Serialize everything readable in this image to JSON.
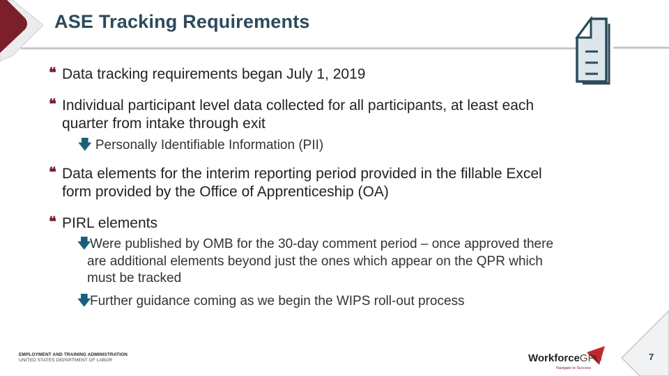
{
  "slide": {
    "title": "ASE Tracking Requirements",
    "page_number": "7",
    "bullets": [
      {
        "text": "Data tracking requirements began July 1, 2019",
        "icon": "quote-bullet-icon"
      },
      {
        "text_lines": [
          "Individual participant level data collected for all participants, at least each",
          "quarter from intake through exit"
        ],
        "icon": "quote-bullet-icon",
        "sub": [
          {
            "text": "Personally Identifiable Information (PII)",
            "icon": "down-arrow-icon"
          }
        ]
      },
      {
        "text_lines": [
          "Data elements for the interim reporting period provided in the fillable Excel",
          "form provided by the Office of Apprenticeship (OA)"
        ],
        "icon": "quote-bullet-icon"
      },
      {
        "text": "PIRL elements",
        "icon": "quote-bullet-icon",
        "sub": [
          {
            "text_lines": [
              "Were published by OMB for the 30-day comment period – once approved there",
              "are additional elements beyond just the ones which appear on the QPR which",
              "must be tracked"
            ],
            "icon": "down-arrow-icon"
          },
          {
            "text": "Further guidance coming as we begin the WIPS roll-out process",
            "icon": "down-arrow-icon"
          }
        ]
      }
    ],
    "glyphs": {
      "quote": "❝",
      "arrow": "🡇"
    }
  },
  "footer": {
    "agency_line1": "EMPLOYMENT AND TRAINING ADMINISTRATION",
    "agency_line2": "UNITED STATES DEPARTMENT OF LABOR",
    "logo_main": "Workforce",
    "logo_accent": "GPS",
    "logo_tagline": "Navigate to Success"
  },
  "colors": {
    "title": "#2c4a5a",
    "accent": "#7b1f2b",
    "arrow": "#1a5f7a"
  }
}
